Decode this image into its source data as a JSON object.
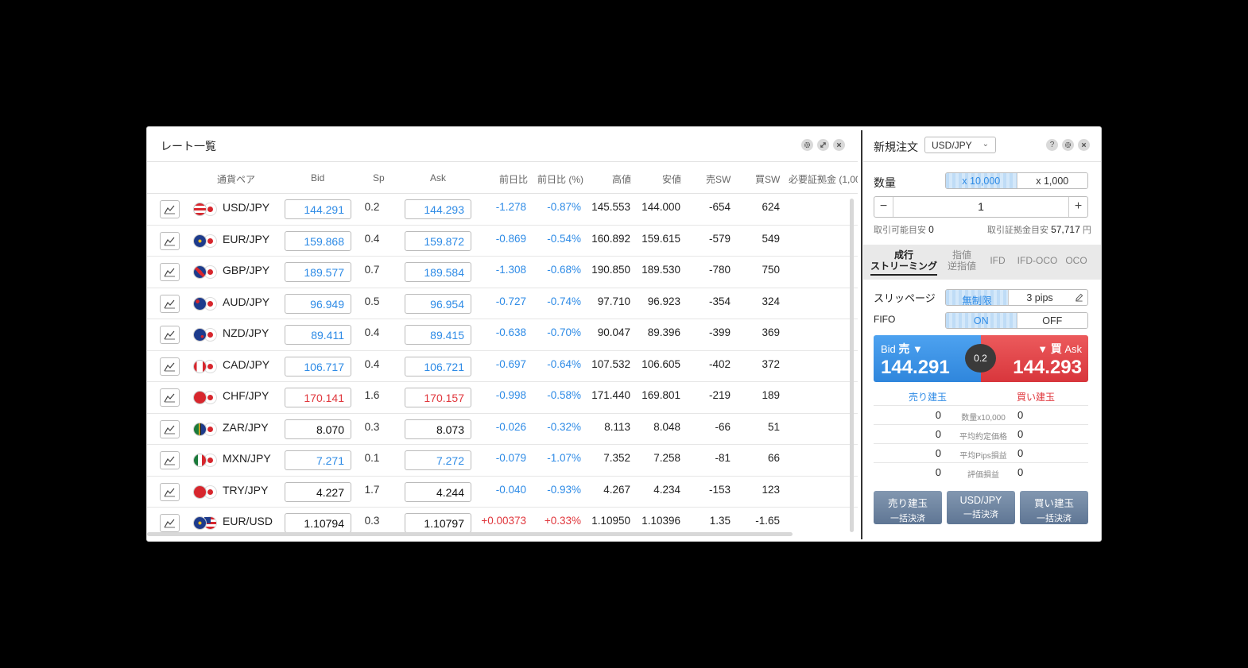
{
  "rate_list": {
    "title": "レート一覧",
    "columns": {
      "pair": "通貨ペア",
      "bid": "Bid",
      "sp": "Sp",
      "ask": "Ask",
      "change": "前日比",
      "change_pct": "前日比 (%)",
      "high": "高値",
      "low": "安値",
      "sell_sw": "売SW",
      "buy_sw": "買SW",
      "margin": "必要証拠金 (1,00"
    },
    "rows": [
      {
        "pair": "USD/JPY",
        "bid": "144.291",
        "sp": "0.2",
        "ask": "144.293",
        "change": "-1.278",
        "change_pct": "-0.87%",
        "high": "145.553",
        "low": "144.000",
        "sell_sw": "-654",
        "buy_sw": "624",
        "price_color": "blue",
        "change_color": "blue",
        "flag_a": "usd",
        "flag_b": "jpy"
      },
      {
        "pair": "EUR/JPY",
        "bid": "159.868",
        "sp": "0.4",
        "ask": "159.872",
        "change": "-0.869",
        "change_pct": "-0.54%",
        "high": "160.892",
        "low": "159.615",
        "sell_sw": "-579",
        "buy_sw": "549",
        "price_color": "blue",
        "change_color": "blue",
        "flag_a": "eur",
        "flag_b": "jpy"
      },
      {
        "pair": "GBP/JPY",
        "bid": "189.577",
        "sp": "0.7",
        "ask": "189.584",
        "change": "-1.308",
        "change_pct": "-0.68%",
        "high": "190.850",
        "low": "189.530",
        "sell_sw": "-780",
        "buy_sw": "750",
        "price_color": "blue",
        "change_color": "blue",
        "flag_a": "gbp",
        "flag_b": "jpy"
      },
      {
        "pair": "AUD/JPY",
        "bid": "96.949",
        "sp": "0.5",
        "ask": "96.954",
        "change": "-0.727",
        "change_pct": "-0.74%",
        "high": "97.710",
        "low": "96.923",
        "sell_sw": "-354",
        "buy_sw": "324",
        "price_color": "blue",
        "change_color": "blue",
        "flag_a": "aud",
        "flag_b": "jpy"
      },
      {
        "pair": "NZD/JPY",
        "bid": "89.411",
        "sp": "0.4",
        "ask": "89.415",
        "change": "-0.638",
        "change_pct": "-0.70%",
        "high": "90.047",
        "low": "89.396",
        "sell_sw": "-399",
        "buy_sw": "369",
        "price_color": "blue",
        "change_color": "blue",
        "flag_a": "nzd",
        "flag_b": "jpy"
      },
      {
        "pair": "CAD/JPY",
        "bid": "106.717",
        "sp": "0.4",
        "ask": "106.721",
        "change": "-0.697",
        "change_pct": "-0.64%",
        "high": "107.532",
        "low": "106.605",
        "sell_sw": "-402",
        "buy_sw": "372",
        "price_color": "blue",
        "change_color": "blue",
        "flag_a": "cad",
        "flag_b": "jpy"
      },
      {
        "pair": "CHF/JPY",
        "bid": "170.141",
        "sp": "1.6",
        "ask": "170.157",
        "change": "-0.998",
        "change_pct": "-0.58%",
        "high": "171.440",
        "low": "169.801",
        "sell_sw": "-219",
        "buy_sw": "189",
        "price_color": "red",
        "change_color": "blue",
        "flag_a": "chf",
        "flag_b": "jpy"
      },
      {
        "pair": "ZAR/JPY",
        "bid": "8.070",
        "sp": "0.3",
        "ask": "8.073",
        "change": "-0.026",
        "change_pct": "-0.32%",
        "high": "8.113",
        "low": "8.048",
        "sell_sw": "-66",
        "buy_sw": "51",
        "price_color": "black",
        "change_color": "blue",
        "flag_a": "zar",
        "flag_b": "jpy"
      },
      {
        "pair": "MXN/JPY",
        "bid": "7.271",
        "sp": "0.1",
        "ask": "7.272",
        "change": "-0.079",
        "change_pct": "-1.07%",
        "high": "7.352",
        "low": "7.258",
        "sell_sw": "-81",
        "buy_sw": "66",
        "price_color": "blue",
        "change_color": "blue",
        "flag_a": "mxn",
        "flag_b": "jpy"
      },
      {
        "pair": "TRY/JPY",
        "bid": "4.227",
        "sp": "1.7",
        "ask": "4.244",
        "change": "-0.040",
        "change_pct": "-0.93%",
        "high": "4.267",
        "low": "4.234",
        "sell_sw": "-153",
        "buy_sw": "123",
        "price_color": "black",
        "change_color": "blue",
        "flag_a": "try",
        "flag_b": "jpy"
      },
      {
        "pair": "EUR/USD",
        "bid": "1.10794",
        "sp": "0.3",
        "ask": "1.10797",
        "change": "+0.00373",
        "change_pct": "+0.33%",
        "high": "1.10950",
        "low": "1.10396",
        "sell_sw": "1.35",
        "buy_sw": "-1.65",
        "price_color": "black",
        "change_color": "red",
        "flag_a": "eur",
        "flag_b": "usd"
      }
    ]
  },
  "order": {
    "title": "新規注文",
    "pair_select": "USD/JPY",
    "quantity_label": "数量",
    "unit_options": [
      "x 10,000",
      "x 1,000"
    ],
    "quantity": "1",
    "minus": "−",
    "plus": "+",
    "tradable_label": "取引可能目安",
    "tradable_value": "0",
    "margin_label": "取引証拠金目安",
    "margin_value": "57,717",
    "margin_unit": "円",
    "tabs": [
      {
        "line1": "成行",
        "line2": "ストリーミング"
      },
      {
        "line1": "指値",
        "line2": "逆指値"
      },
      {
        "line1": "IFD",
        "line2": ""
      },
      {
        "line1": "IFD-OCO",
        "line2": ""
      },
      {
        "line1": "OCO",
        "line2": ""
      }
    ],
    "slippage_label": "スリッページ",
    "slippage_options": [
      "無制限",
      "3 pips"
    ],
    "fifo_label": "FIFO",
    "fifo_options": [
      "ON",
      "OFF"
    ],
    "bid_label": "Bid",
    "sell_label": "売",
    "bid_price": "144.291",
    "buy_label": "買",
    "ask_label": "Ask",
    "ask_price": "144.293",
    "spread": "0.2",
    "sell_pos_label": "売り建玉",
    "buy_pos_label": "買い建玉",
    "positions": [
      {
        "sell": "0",
        "label": "数量x10,000",
        "buy": "0"
      },
      {
        "sell": "0",
        "label": "平均約定価格",
        "buy": "0"
      },
      {
        "sell": "0",
        "label": "平均Pips損益",
        "buy": "0"
      },
      {
        "sell": "0",
        "label": "評価損益",
        "buy": "0"
      }
    ],
    "bulk_buttons": [
      {
        "line1": "売り建玉",
        "line2": "一括決済"
      },
      {
        "line1": "USD/JPY",
        "line2": "一括決済"
      },
      {
        "line1": "買い建玉",
        "line2": "一括決済"
      }
    ]
  },
  "icons": {
    "settings": "gear-icon",
    "expand": "expand-icon",
    "close": "close-icon",
    "help": "help-icon",
    "chart": "chart-icon",
    "edit": "pencil-icon"
  },
  "colors": {
    "blue": "#2e8be6",
    "red": "#e0373d",
    "bid_bg": "#2f86dc",
    "ask_bg": "#d8363c"
  }
}
